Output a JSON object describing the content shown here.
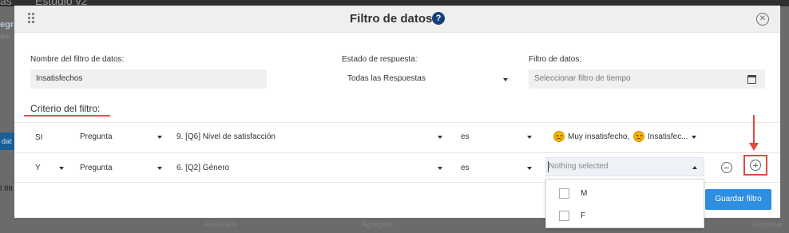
{
  "background": {
    "title_fragment": "Estudio v2",
    "title_fragment_left": "as",
    "left_fragment_1": "egra",
    "left_fragment_2": "álisi",
    "left_button_fragment": "dat",
    "left_fragment_3": "l filt",
    "bottom_fragment_1": "Finalizada",
    "bottom_fragment_2": "Agregado",
    "bottom_fragment_3": "Recopilar"
  },
  "modal": {
    "title": "Filtro de datos",
    "help_icon_glyph": "?",
    "close_icon_glyph": "✕"
  },
  "form": {
    "name_label": "Nombre del filtro de datos:",
    "name_value": "Insatisfechos",
    "status_label": "Estado de respuesta:",
    "status_value": "Todas las Respuestas",
    "date_label": "Filtro de datos:",
    "date_placeholder": "Seleccionar filtro de tiempo"
  },
  "criteria": {
    "title": "Criterio del filtro:",
    "rows": [
      {
        "connector": "SI",
        "type": "Pregunta",
        "question": "9. [Q6] Nivel de satisfacción",
        "operator": "es",
        "values": [
          "Muy insatisfecho,",
          "Insatisfec..."
        ]
      },
      {
        "connector": "Y",
        "type": "Pregunta",
        "question": "6. [Q2] Género",
        "operator": "es",
        "value_placeholder": "Nothing selected"
      }
    ]
  },
  "dropdown_options": [
    "M",
    "F"
  ],
  "actions": {
    "save_label": "Guardar filtro"
  },
  "colors": {
    "primary_button": "#2e8ee0",
    "help_icon": "#173e7a",
    "annotation_red": "#e04a3f",
    "emoji_yellow": "#f4b400"
  }
}
